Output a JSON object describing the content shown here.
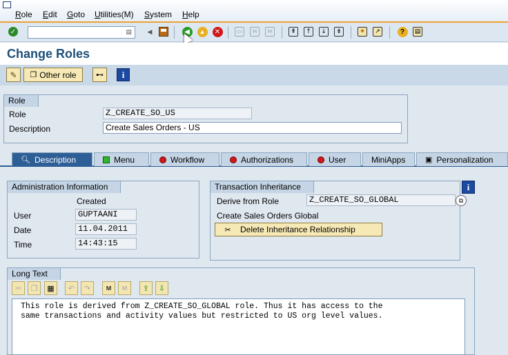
{
  "menubar": {
    "items": [
      {
        "label": "Role",
        "ul": "R",
        "rest": "ole"
      },
      {
        "label": "Edit",
        "ul": "E",
        "rest": "dit"
      },
      {
        "label": "Goto",
        "ul": "G",
        "rest": "oto"
      },
      {
        "label": "Utilities(M)",
        "ul": "U",
        "rest": "tilities(M)"
      },
      {
        "label": "System",
        "ul": "S",
        "rest": "ystem"
      },
      {
        "label": "Help",
        "ul": "H",
        "rest": "elp"
      }
    ]
  },
  "toolbar": {
    "command_field_value": ""
  },
  "page": {
    "title": "Change Roles"
  },
  "apptoolbar": {
    "other_role_label": "Other role"
  },
  "role_group": {
    "heading": "Role",
    "role_label": "Role",
    "role_value": "Z_CREATE_SO_US",
    "description_label": "Description",
    "description_value": "Create Sales Orders - US"
  },
  "tabs": [
    {
      "label": "Description",
      "status": "active"
    },
    {
      "label": "Menu",
      "status": "green"
    },
    {
      "label": "Workflow",
      "status": "red"
    },
    {
      "label": "Authorizations",
      "status": "red"
    },
    {
      "label": "User",
      "status": "red"
    },
    {
      "label": "MiniApps",
      "status": "none"
    },
    {
      "label": "Personalization",
      "status": "icon"
    }
  ],
  "admin_info": {
    "heading": "Administration Information",
    "created_label": "Created",
    "user_label": "User",
    "user_value": "GUPTAANI",
    "date_label": "Date",
    "date_value": "11.04.2011",
    "time_label": "Time",
    "time_value": "14:43:15"
  },
  "inheritance": {
    "heading": "Transaction Inheritance",
    "derive_label": "Derive from Role",
    "derive_value": "Z_CREATE_SO_GLOBAL",
    "derive_description": "Create Sales Orders Global",
    "delete_button_label": "Delete Inheritance Relationship"
  },
  "long_text": {
    "heading": "Long Text",
    "content": "This role is derived from Z_CREATE_SO_GLOBAL role. Thus it has access to the\nsame transactions and activity values but restricted to US org level values."
  },
  "colors": {
    "accent": "#2d5e96",
    "title": "#1d4f7a",
    "button_bg": "#f6e9b5",
    "status_red": "#d01818",
    "status_green": "#2eb82e"
  }
}
